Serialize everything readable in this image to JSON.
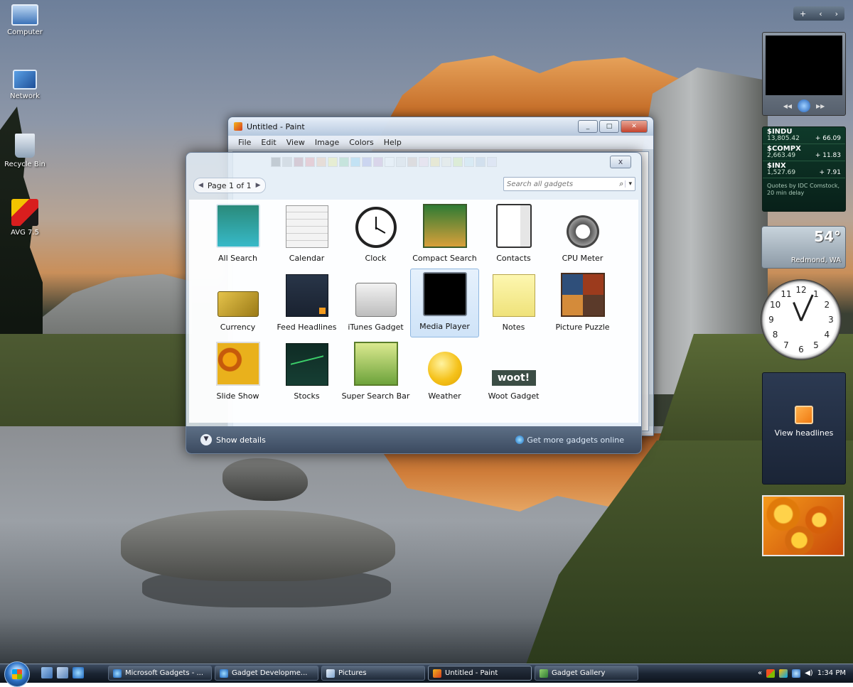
{
  "desktop": {
    "icons": [
      {
        "label": "Computer"
      },
      {
        "label": "Network"
      },
      {
        "label": "Recycle Bin"
      },
      {
        "label": "AVG 7.5"
      }
    ]
  },
  "paint": {
    "title": "Untitled - Paint",
    "menu": [
      "File",
      "Edit",
      "View",
      "Image",
      "Colors",
      "Help"
    ],
    "palette": [
      "#000000",
      "#7f7f7f",
      "#880015",
      "#ed1c24",
      "#ff7f27",
      "#fff200",
      "#22b14c",
      "#00a2e8",
      "#3f48cc",
      "#a349a4",
      "#ffffff",
      "#c3c3c3",
      "#b97a57",
      "#ffaec9",
      "#ffc90e",
      "#efe4b0",
      "#b5e61d",
      "#99d9ea",
      "#7092be",
      "#c8bfe7"
    ]
  },
  "gallery": {
    "close_label": "x",
    "pager": "Page 1 of 1",
    "search_placeholder": "Search all gadgets",
    "items": [
      {
        "label": "All Search",
        "icon": "all-search-icon"
      },
      {
        "label": "Calendar",
        "icon": "calendar-icon"
      },
      {
        "label": "Clock",
        "icon": "clock-icon"
      },
      {
        "label": "Compact Search",
        "icon": "compact-search-icon"
      },
      {
        "label": "Contacts",
        "icon": "contacts-icon"
      },
      {
        "label": "CPU Meter",
        "icon": "cpu-meter-icon"
      },
      {
        "label": "Currency",
        "icon": "currency-icon"
      },
      {
        "label": "Feed Headlines",
        "icon": "feed-headlines-icon"
      },
      {
        "label": "iTunes Gadget",
        "icon": "itunes-gadget-icon"
      },
      {
        "label": "Media Player",
        "icon": "media-player-icon",
        "selected": true
      },
      {
        "label": "Notes",
        "icon": "notes-icon"
      },
      {
        "label": "Picture Puzzle",
        "icon": "picture-puzzle-icon"
      },
      {
        "label": "Slide Show",
        "icon": "slide-show-icon"
      },
      {
        "label": "Stocks",
        "icon": "stocks-icon"
      },
      {
        "label": "Super Search Bar",
        "icon": "super-search-bar-icon"
      },
      {
        "label": "Weather",
        "icon": "weather-icon"
      },
      {
        "label": "Woot Gadget",
        "icon": "woot-gadget-icon",
        "badge": "woot!"
      }
    ],
    "show_details": "Show details",
    "get_more": "Get more gadgets online"
  },
  "sidebar": {
    "controls": [
      "+",
      "‹",
      "›"
    ],
    "stocks": [
      {
        "symbol": "$INDU",
        "price": "13,805.42",
        "change": "+ 66.09"
      },
      {
        "symbol": "$COMPX",
        "price": "2,663.49",
        "change": "+ 11.83"
      },
      {
        "symbol": "$INX",
        "price": "1,527.69",
        "change": "+ 7.91"
      }
    ],
    "stocks_footer": "Quotes by IDC Comstock, 20 min delay",
    "weather": {
      "temp": "54°",
      "city": "Redmond, WA"
    },
    "clock": {
      "numbers": [
        "12",
        "1",
        "2",
        "3",
        "4",
        "5",
        "6",
        "7",
        "8",
        "9",
        "10",
        "11"
      ]
    },
    "news_label": "View headlines"
  },
  "taskbar": {
    "tasks": [
      {
        "label": "Microsoft Gadgets - ..."
      },
      {
        "label": "Gadget Developme..."
      },
      {
        "label": "Pictures"
      },
      {
        "label": "Untitled - Paint",
        "active": true
      },
      {
        "label": "Gadget Gallery"
      }
    ],
    "clock": "1:34 PM"
  }
}
